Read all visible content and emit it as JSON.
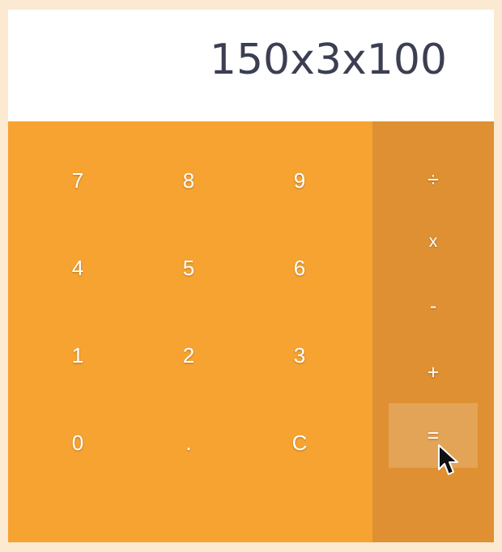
{
  "display": {
    "expression": "150x3x100"
  },
  "digits": [
    {
      "label": "7",
      "name": "key-7"
    },
    {
      "label": "8",
      "name": "key-8"
    },
    {
      "label": "9",
      "name": "key-9"
    },
    {
      "label": "4",
      "name": "key-4"
    },
    {
      "label": "5",
      "name": "key-5"
    },
    {
      "label": "6",
      "name": "key-6"
    },
    {
      "label": "1",
      "name": "key-1"
    },
    {
      "label": "2",
      "name": "key-2"
    },
    {
      "label": "3",
      "name": "key-3"
    },
    {
      "label": "0",
      "name": "key-0"
    },
    {
      "label": ".",
      "name": "key-decimal"
    },
    {
      "label": "C",
      "name": "key-clear"
    }
  ],
  "operators": {
    "divide": "÷",
    "multiply": "x",
    "subtract": "-",
    "add": "+",
    "equals": "="
  },
  "colors": {
    "background": "#fbe9d2",
    "display": "#ffffff",
    "digit_panel": "#f6a332",
    "operator_panel": "#df9032",
    "text": "#3c3f52",
    "key_text": "#ffffff"
  },
  "cursor": {
    "icon": "mouse-pointer-icon"
  }
}
